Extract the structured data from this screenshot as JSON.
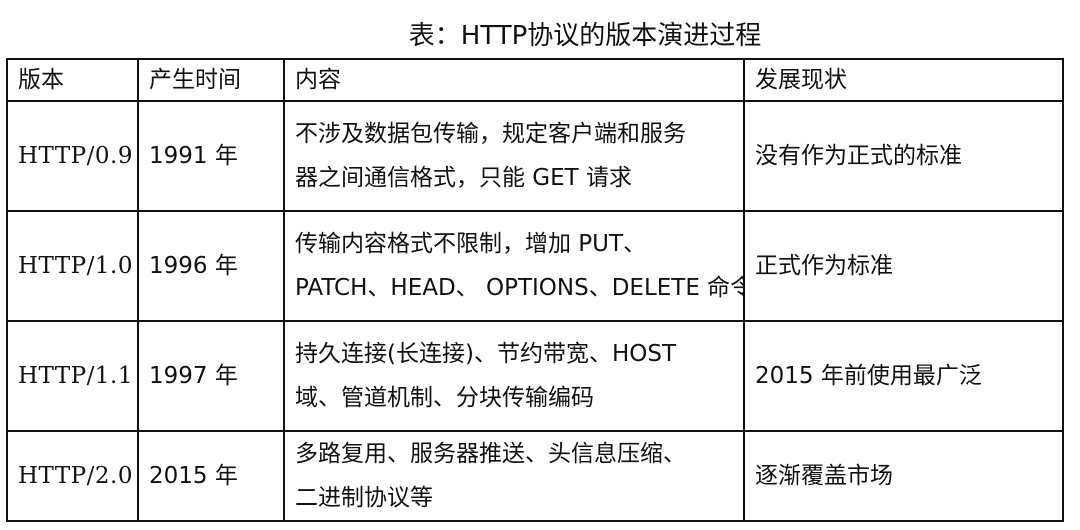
{
  "title": "表：HTTP协议的版本演进过程",
  "table": {
    "headers": [
      "版本",
      "产生时间",
      "内容",
      "发展现状"
    ],
    "rows": [
      {
        "version": "HTTP/0.9",
        "year": "1991 年",
        "content_line1": "不涉及数据包传输，规定客户端和服务",
        "content_line2": "器之间通信格式，只能 GET 请求",
        "status": "没有作为正式的标准"
      },
      {
        "version": "HTTP/1.0",
        "year": "1996 年",
        "content_line1": "传输内容格式不限制，增加 PUT、",
        "content_line2": "PATCH、HEAD、 OPTIONS、DELETE 命令",
        "status": "正式作为标准"
      },
      {
        "version": "HTTP/1.1",
        "year": "1997 年",
        "content_line1": "持久连接(长连接)、节约带宽、HOST",
        "content_line2": "域、管道机制、分块传输编码",
        "status": "2015 年前使用最广泛"
      },
      {
        "version": "HTTP/2.0",
        "year": "2015 年",
        "content_line1": "多路复用、服务器推送、头信息压缩、",
        "content_line2": "二进制协议等",
        "status": "逐渐覆盖市场"
      }
    ]
  }
}
